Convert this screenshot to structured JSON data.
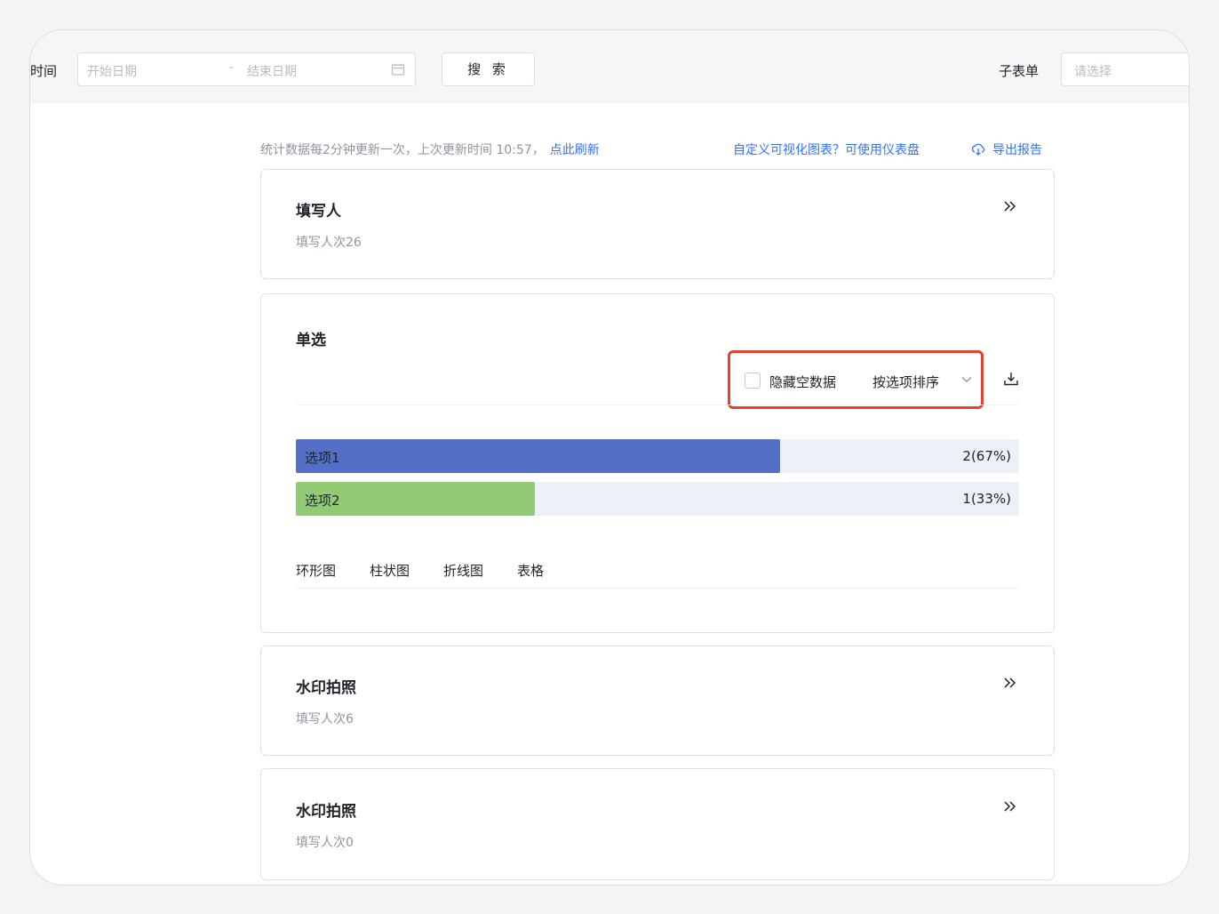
{
  "filters": {
    "time_label": "时间",
    "start_placeholder": "开始日期",
    "separator": "-",
    "end_placeholder": "结束日期",
    "search_label": "搜 索",
    "sub_form_label": "子表单",
    "sub_form_placeholder": "请选择"
  },
  "info": {
    "update_text": "统计数据每2分钟更新一次，上次更新时间 10:57，",
    "refresh_link": "点此刷新",
    "dashboard_link": "自定义可视化图表？可使用仪表盘",
    "export_link": "导出报告"
  },
  "cards": [
    {
      "title": "填写人",
      "subtitle": "填写人次26"
    },
    {
      "title": "单选",
      "hide_empty_label": "隐藏空数据",
      "sort_label": "按选项排序",
      "options": [
        {
          "label": "选项1",
          "value": "2(67%)",
          "fraction": 0.67,
          "color": "#5470c6"
        },
        {
          "label": "选项2",
          "value": "1(33%)",
          "fraction": 0.33,
          "color": "#91cc75"
        }
      ],
      "tabs": [
        "环形图",
        "柱状图",
        "折线图",
        "表格"
      ]
    },
    {
      "title": "水印拍照",
      "subtitle": "填写人次6"
    },
    {
      "title": "水印拍照",
      "subtitle": "填写人次0"
    }
  ]
}
